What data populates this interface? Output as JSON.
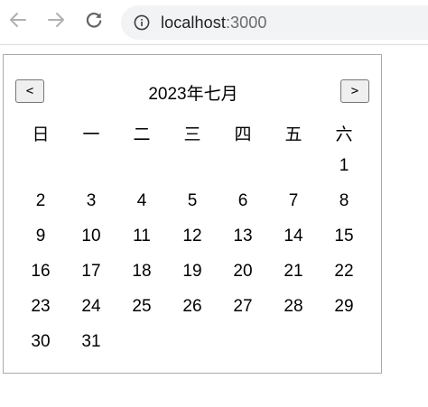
{
  "browser": {
    "url_host": "localhost",
    "url_port": ":3000",
    "icons": [
      "back-arrow-icon",
      "forward-arrow-icon",
      "reload-icon",
      "info-icon"
    ]
  },
  "calendar": {
    "prev_label": "<",
    "next_label": ">",
    "title": "2023年七月",
    "weekdays": [
      "日",
      "一",
      "二",
      "三",
      "四",
      "五",
      "六"
    ],
    "first_weekday_index": 6,
    "days": [
      "1",
      "2",
      "3",
      "4",
      "5",
      "6",
      "7",
      "8",
      "9",
      "10",
      "11",
      "12",
      "13",
      "14",
      "15",
      "16",
      "17",
      "18",
      "19",
      "20",
      "21",
      "22",
      "23",
      "24",
      "25",
      "26",
      "27",
      "28",
      "29",
      "30",
      "31"
    ]
  }
}
